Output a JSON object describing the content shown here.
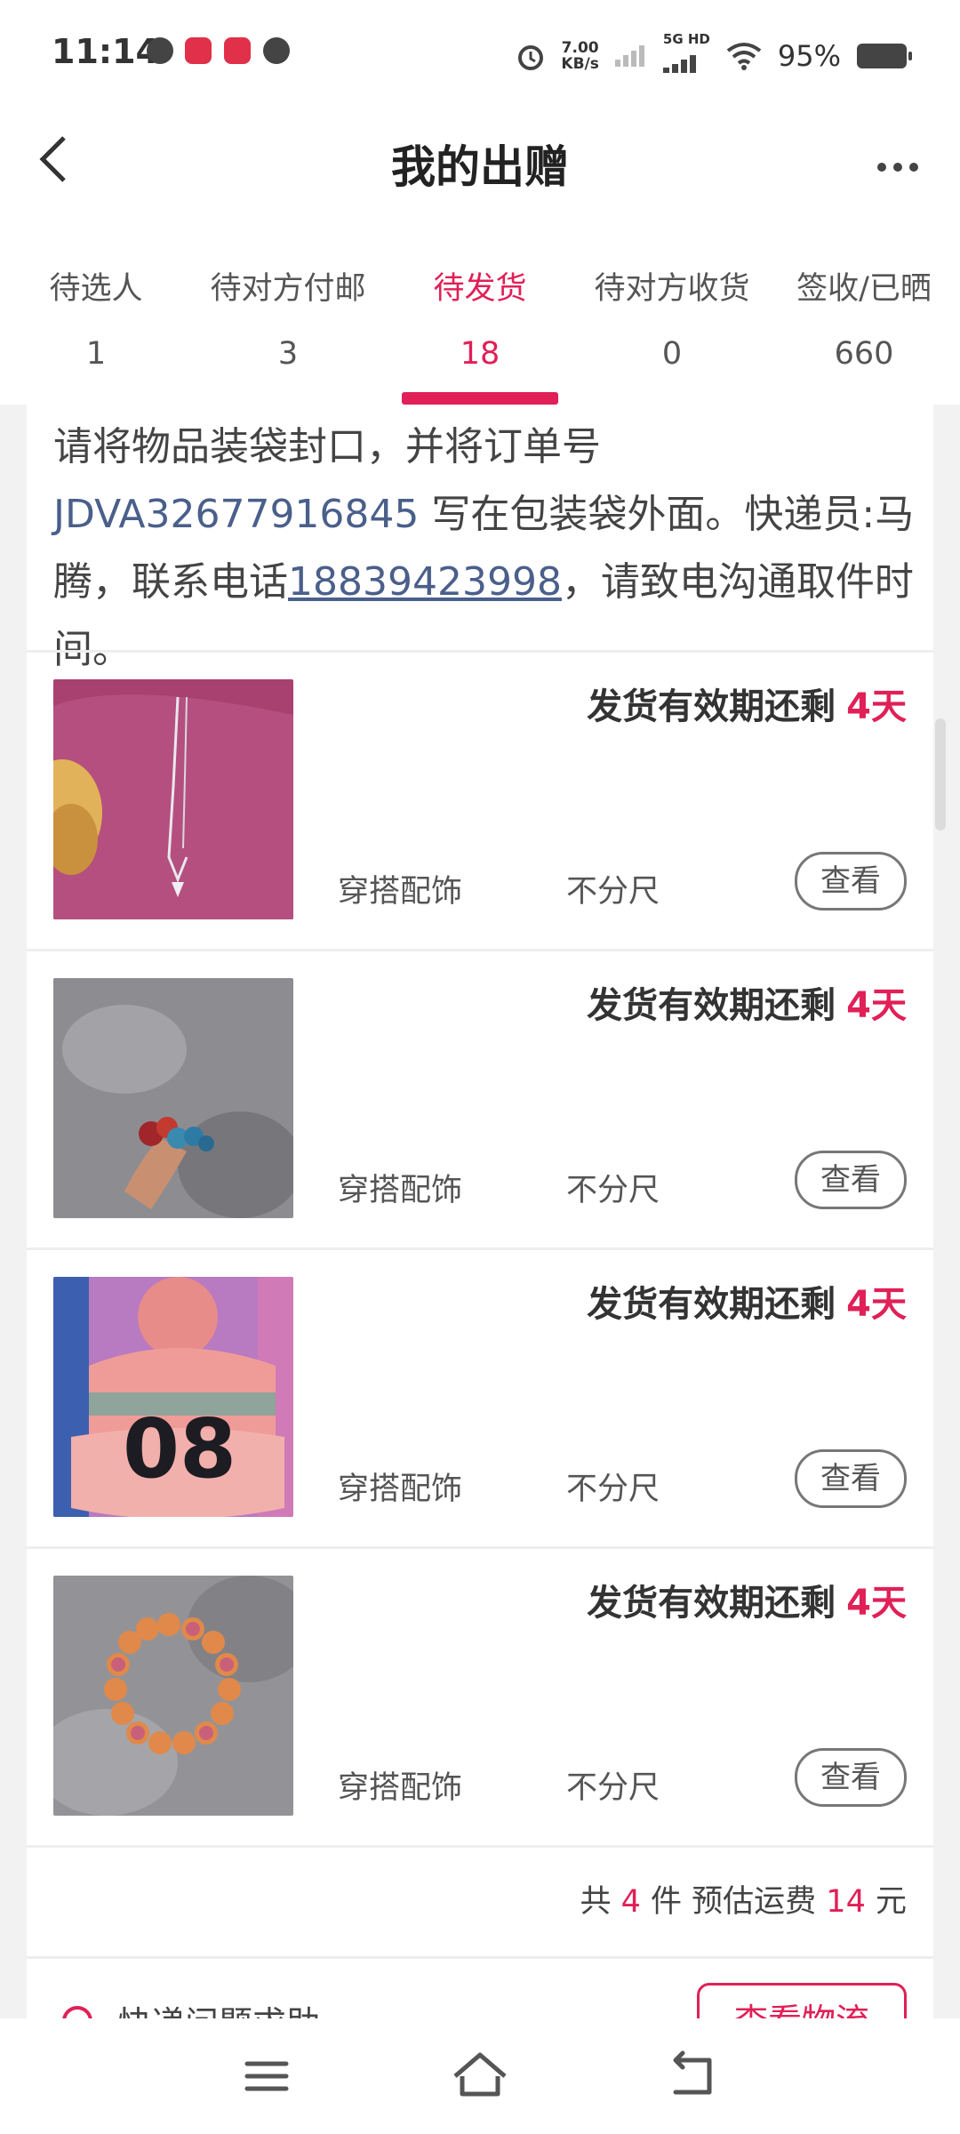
{
  "status_bar": {
    "time": "11:14",
    "net_speed_value": "7.00",
    "net_speed_unit": "KB/s",
    "network": "5G HD",
    "battery": "95%"
  },
  "header": {
    "title": "我的出赠"
  },
  "tabs": [
    {
      "label": "待选人",
      "count": "1",
      "active": false
    },
    {
      "label": "待对方付邮",
      "count": "3",
      "active": false
    },
    {
      "label": "待发货",
      "count": "18",
      "active": true
    },
    {
      "label": "待对方收货",
      "count": "0",
      "active": false
    },
    {
      "label": "签收/已晒",
      "count": "660",
      "active": false
    }
  ],
  "notice": {
    "part1": "请将物品装袋封口，并将订单号 ",
    "order_no": "JDVA32677916845",
    "part2": " 写在包装袋外面。快递员:马腾，联系电话",
    "phone": "18839423998",
    "part3": "，请致电沟通取件时间。"
  },
  "items": [
    {
      "deadline_label": "发货有效期还剩",
      "days": "4天",
      "category": "穿搭配饰",
      "size": "不分尺",
      "button": "查看",
      "image": "necklace"
    },
    {
      "deadline_label": "发货有效期还剩",
      "days": "4天",
      "category": "穿搭配饰",
      "size": "不分尺",
      "button": "查看",
      "image": "flower-hairclip"
    },
    {
      "deadline_label": "发货有效期还剩",
      "days": "4天",
      "category": "穿搭配饰",
      "size": "不分尺",
      "button": "查看",
      "image": "knit-hat"
    },
    {
      "deadline_label": "发货有效期还剩",
      "days": "4天",
      "category": "穿搭配饰",
      "size": "不分尺",
      "button": "查看",
      "image": "bead-bracelet"
    }
  ],
  "summary": {
    "prefix": "共",
    "count": "4",
    "mid": "件 预估运费",
    "fee": "14",
    "suffix": "元"
  },
  "footer": {
    "help_label": "快递问题求助",
    "logistics_button": "查看物流"
  },
  "colors": {
    "accent": "#e02057",
    "link": "#4a5f8a"
  }
}
